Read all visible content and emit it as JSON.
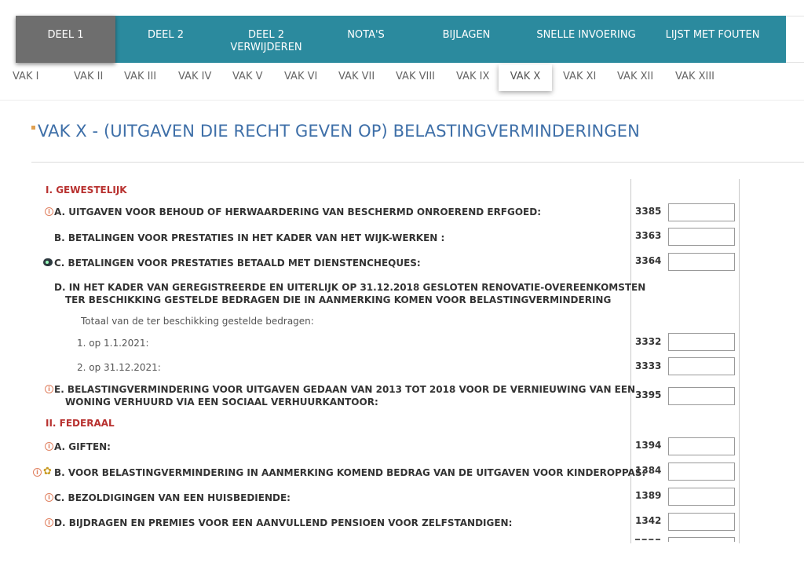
{
  "topnav": {
    "tabs": [
      {
        "line1": "DEEL 1",
        "line2": ""
      },
      {
        "line1": "DEEL 2",
        "line2": ""
      },
      {
        "line1": "DEEL 2",
        "line2": "VERWIJDEREN"
      },
      {
        "line1": "NOTA'S",
        "line2": ""
      },
      {
        "line1": "BIJLAGEN",
        "line2": ""
      },
      {
        "line1": "SNELLE INVOERING",
        "line2": ""
      },
      {
        "line1": "LIJST MET FOUTEN",
        "line2": ""
      }
    ],
    "active_index": 0
  },
  "subnav": {
    "items": [
      "VAK I",
      "VAK II",
      "VAK III",
      "VAK IV",
      "VAK V",
      "VAK VI",
      "VAK VII",
      "VAK VIII",
      "VAK IX",
      "VAK X",
      "VAK XI",
      "VAK XII",
      "VAK XIII"
    ],
    "active": "VAK X"
  },
  "page": {
    "title": "VAK X - (UITGAVEN DIE RECHT GEVEN OP) BELASTINGVERMINDERINGEN"
  },
  "form": {
    "section_gewestelijk": "I. GEWESTELIJK",
    "section_federaal": "II. FEDERAAL",
    "rows": {
      "g_a": {
        "label": "A. UITGAVEN VOOR BEHOUD OF HERWAARDERING VAN BESCHERMD ONROEREND ERFGOED:",
        "code": "3385",
        "value": ""
      },
      "g_b": {
        "label": "B. BETALINGEN VOOR PRESTATIES IN HET KADER VAN HET WIJK-WERKEN :",
        "code": "3363",
        "value": ""
      },
      "g_c": {
        "label": "C. BETALINGEN VOOR PRESTATIES BETAALD MET DIENSTENCHEQUES:",
        "code": "3364",
        "value": ""
      },
      "g_d": {
        "line1": "D. IN HET KADER VAN GEREGISTREERDE EN UITERLIJK OP 31.12.2018 GESLOTEN RENOVATIE-OVEREENKOMSTEN",
        "line2": "TER BESCHIKKING GESTELDE BEDRAGEN DIE IN AANMERKING KOMEN VOOR BELASTINGVERMINDERING"
      },
      "g_d_total": {
        "label": "Totaal van de ter beschikking gestelde bedragen:"
      },
      "g_d_1": {
        "label": "1. op 1.1.2021:",
        "code": "3332",
        "value": ""
      },
      "g_d_2": {
        "label": "2. op 31.12.2021:",
        "code": "3333",
        "value": ""
      },
      "g_e": {
        "line1": "E. BELASTINGVERMINDERING VOOR UITGAVEN GEDAAN VAN 2013 TOT 2018 VOOR DE VERNIEUWING VAN EEN",
        "line2": "WONING VERHUURD VIA EEN SOCIAAL VERHUURKANTOOR:",
        "code": "3395",
        "value": ""
      },
      "f_a": {
        "label": "A. GIFTEN:",
        "code": "1394",
        "value": ""
      },
      "f_b": {
        "label": "B. VOOR BELASTINGVERMINDERING IN AANMERKING KOMEND BEDRAG VAN DE UITGAVEN VOOR KINDEROPPAS:",
        "code": "1384",
        "value": ""
      },
      "f_c": {
        "label": "C. BEZOLDIGINGEN VAN EEN HUISBEDIENDE:",
        "code": "1389",
        "value": ""
      },
      "f_d": {
        "label": "D. BIJDRAGEN EN PREMIES VOOR EEN AANVULLEND PENSIOEN VOOR ZELFSTANDIGEN:",
        "code": "1342",
        "value": ""
      }
    }
  },
  "icons": {
    "info": "info-icon",
    "service_cheque": "service-cheque-icon",
    "childcare": "childcare-icon"
  },
  "colors": {
    "nav_bg": "#2b8a9e",
    "nav_active": "#6e6e6e",
    "title": "#3e6fa8",
    "section": "#b8312f"
  }
}
